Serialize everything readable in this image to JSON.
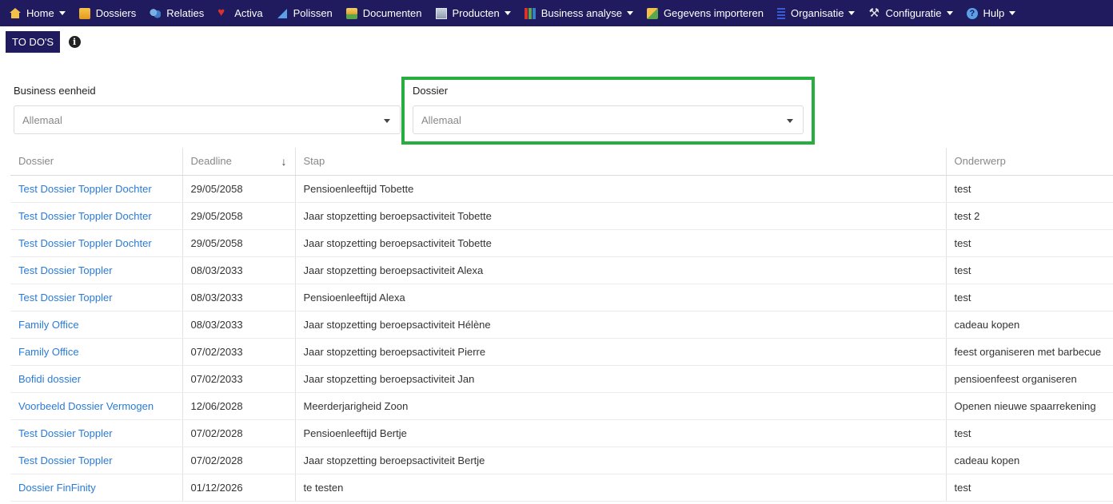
{
  "nav": {
    "items": [
      {
        "label": "Home",
        "icon": "home-icon",
        "dropdown": true
      },
      {
        "label": "Dossiers",
        "icon": "folder-icon",
        "dropdown": false
      },
      {
        "label": "Relaties",
        "icon": "relations-icon",
        "dropdown": false
      },
      {
        "label": "Activa",
        "icon": "heart-icon",
        "dropdown": false
      },
      {
        "label": "Polissen",
        "icon": "policy-icon",
        "dropdown": false
      },
      {
        "label": "Documenten",
        "icon": "documents-icon",
        "dropdown": false
      },
      {
        "label": "Producten",
        "icon": "products-icon",
        "dropdown": true
      },
      {
        "label": "Business analyse",
        "icon": "bar-chart-icon",
        "dropdown": true
      },
      {
        "label": "Gegevens importeren",
        "icon": "import-icon",
        "dropdown": false
      },
      {
        "label": "Organisatie",
        "icon": "organization-icon",
        "dropdown": true
      },
      {
        "label": "Configuratie",
        "icon": "tools-icon",
        "dropdown": true
      },
      {
        "label": "Hulp",
        "icon": "help-icon",
        "dropdown": true
      }
    ]
  },
  "tabs": {
    "todo_label": "TO DO'S",
    "info_icon": "info-icon"
  },
  "filters": {
    "business": {
      "label": "Business eenheid",
      "value": "Allemaal"
    },
    "dossier": {
      "label": "Dossier",
      "value": "Allemaal"
    }
  },
  "colors": {
    "navbar": "#201a5e",
    "link": "#2a7bd6",
    "highlight": "#27ae3f"
  },
  "table": {
    "headers": [
      "Dossier",
      "Deadline",
      "Stap",
      "Onderwerp"
    ],
    "sorted_column": "Deadline",
    "sort_direction": "descending",
    "rows": [
      [
        "Test Dossier Toppler Dochter",
        "29/05/2058",
        "Pensioenleeftijd Tobette",
        "test"
      ],
      [
        "Test Dossier Toppler Dochter",
        "29/05/2058",
        "Jaar stopzetting beroepsactiviteit Tobette",
        "test 2"
      ],
      [
        "Test Dossier Toppler Dochter",
        "29/05/2058",
        "Jaar stopzetting beroepsactiviteit Tobette",
        "test"
      ],
      [
        "Test Dossier Toppler",
        "08/03/2033",
        "Jaar stopzetting beroepsactiviteit Alexa",
        "test"
      ],
      [
        "Test Dossier Toppler",
        "08/03/2033",
        "Pensioenleeftijd Alexa",
        "test"
      ],
      [
        "Family Office",
        "08/03/2033",
        "Jaar stopzetting beroepsactiviteit Hélène",
        "cadeau kopen"
      ],
      [
        "Family Office",
        "07/02/2033",
        "Jaar stopzetting beroepsactiviteit Pierre",
        "feest organiseren met barbecue"
      ],
      [
        "Bofidi dossier",
        "07/02/2033",
        "Jaar stopzetting beroepsactiviteit Jan",
        "pensioenfeest organiseren"
      ],
      [
        "Voorbeeld Dossier Vermogen",
        "12/06/2028",
        "Meerderjarigheid Zoon",
        "Openen nieuwe spaarrekening"
      ],
      [
        "Test Dossier Toppler",
        "07/02/2028",
        "Pensioenleeftijd Bertje",
        "test"
      ],
      [
        "Test Dossier Toppler",
        "07/02/2028",
        "Jaar stopzetting beroepsactiviteit Bertje",
        "cadeau kopen"
      ],
      [
        "Dossier FinFinity",
        "01/12/2026",
        "te testen",
        "test"
      ]
    ]
  }
}
